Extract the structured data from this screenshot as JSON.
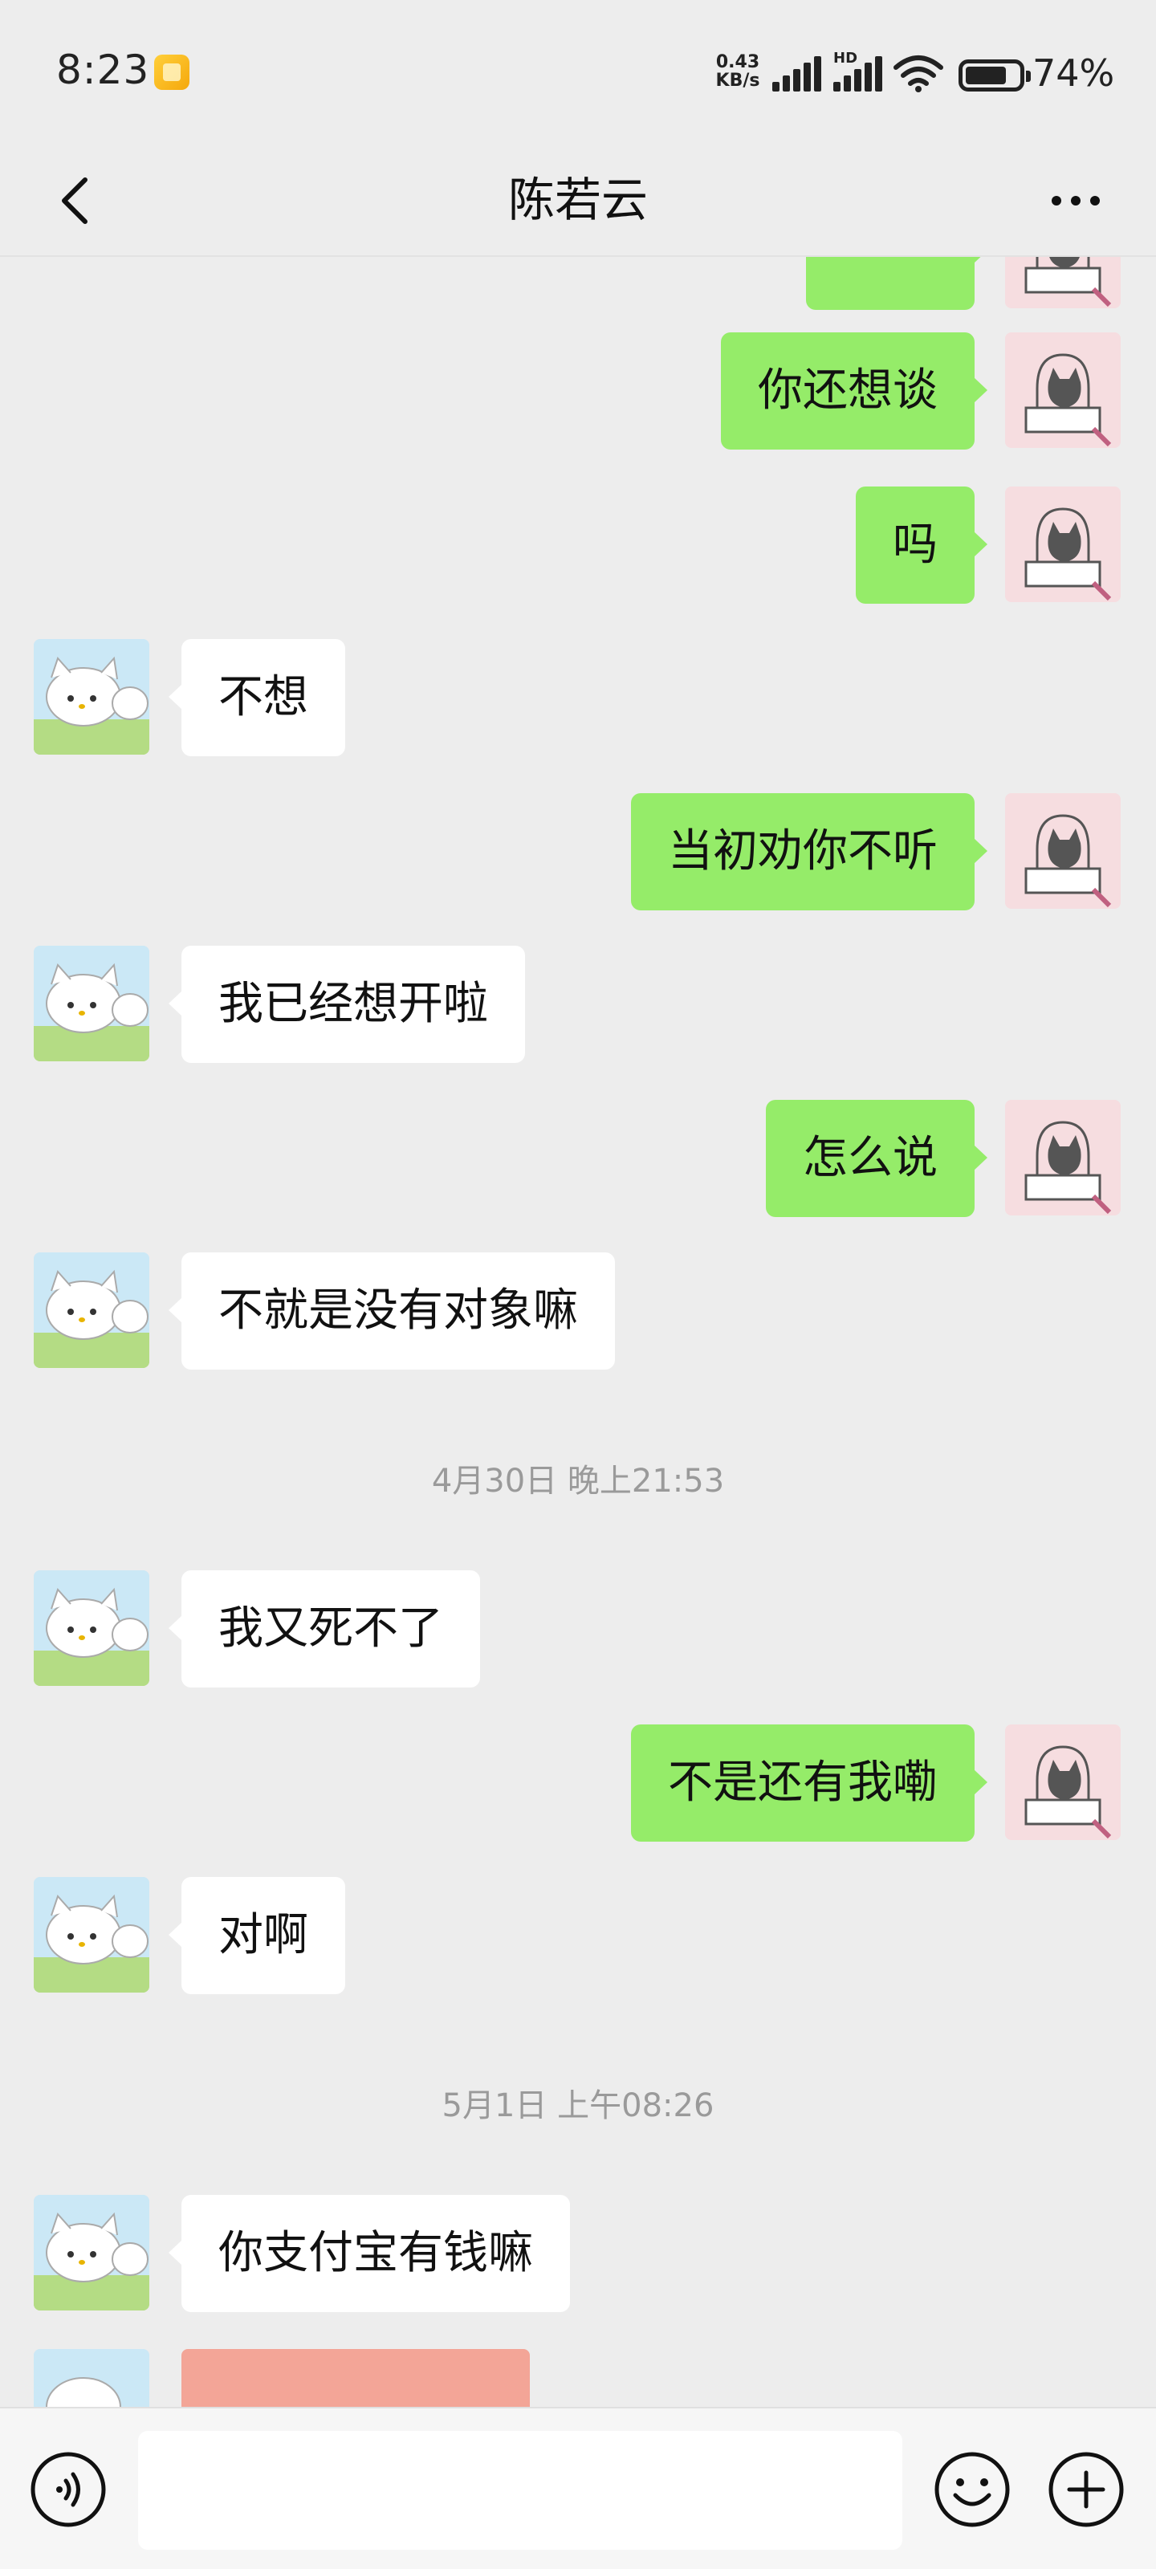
{
  "status_bar": {
    "time": "8:23",
    "net_speed_value": "0.43",
    "net_speed_unit": "KB/s",
    "hd_label": "HD",
    "battery": "74%"
  },
  "header": {
    "title": "陈若云"
  },
  "messages": [
    {
      "side": "mine",
      "text": "…"
    },
    {
      "side": "mine",
      "text": "你还想谈"
    },
    {
      "side": "mine",
      "text": "吗"
    },
    {
      "side": "theirs",
      "text": "不想"
    },
    {
      "side": "mine",
      "text": "当初劝你不听"
    },
    {
      "side": "theirs",
      "text": "我已经想开啦"
    },
    {
      "side": "mine",
      "text": "怎么说"
    },
    {
      "side": "theirs",
      "text": "不就是没有对象嘛"
    },
    {
      "side": "time",
      "text": "4月30日 晚上21:53"
    },
    {
      "side": "theirs",
      "text": "我又死不了"
    },
    {
      "side": "mine",
      "text": "不是还有我嘞"
    },
    {
      "side": "theirs",
      "text": "对啊"
    },
    {
      "side": "time",
      "text": "5月1日 上午08:26"
    },
    {
      "side": "theirs",
      "text": "你支付宝有钱嘛"
    },
    {
      "side": "theirs",
      "text": "[image]"
    }
  ],
  "input": {
    "value": ""
  },
  "colors": {
    "background": "#ededed",
    "mine_bubble": "#95ec69",
    "theirs_bubble": "#ffffff",
    "timestamp": "#9a9a9a"
  },
  "icons": {
    "back": "chevron-left-icon",
    "more": "more-dots-icon",
    "voice": "voice-icon",
    "emoji": "emoji-icon",
    "plus": "plus-icon"
  }
}
